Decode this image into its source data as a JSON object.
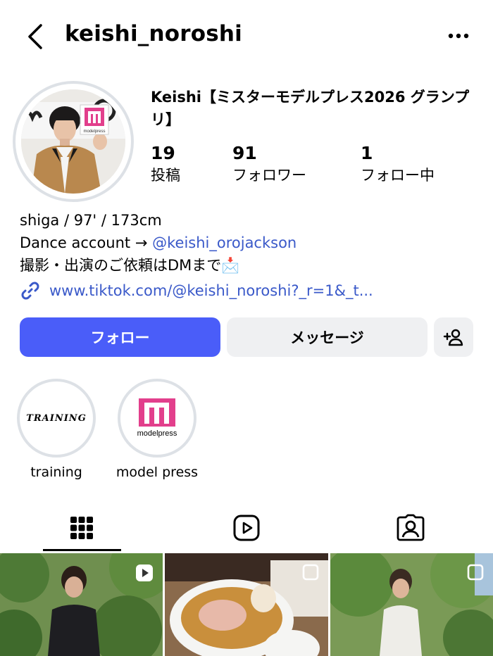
{
  "header": {
    "username": "keishi_noroshi",
    "back_icon": "chevron-left-icon",
    "more_icon": "more-horizontal-icon"
  },
  "profile": {
    "full_name": "Keishi【ミスターモデルプレス2026 グランプリ】",
    "stats": [
      {
        "value": "19",
        "label": "投稿"
      },
      {
        "value": "91",
        "label": "フォロワー"
      },
      {
        "value": "1",
        "label": "フォロー中"
      }
    ],
    "bio": {
      "line1": "shiga / 97' / 173cm",
      "line2_prefix": "Dance account → ",
      "line2_mention": "@keishi_orojackson",
      "line3": "撮影・出演のご依頼はDMまで📩"
    },
    "link": "www.tiktok.com/@keishi_noroshi?_r=1&_t..."
  },
  "actions": {
    "follow_label": "フォロー",
    "message_label": "メッセージ",
    "add_user_icon": "add-person-icon"
  },
  "highlights": [
    {
      "title": "training",
      "cover_text": "TRAINING"
    },
    {
      "title": "model press",
      "cover_text": "modelpress"
    }
  ],
  "tabs": [
    {
      "name": "grid",
      "icon": "grid-icon",
      "active": true
    },
    {
      "name": "reels",
      "icon": "reels-icon",
      "active": false
    },
    {
      "name": "tagged",
      "icon": "tagged-person-icon",
      "active": false
    }
  ],
  "colors": {
    "accent": "#4a5df9",
    "link": "#3a59c9",
    "button_bg": "#eff0f2"
  }
}
